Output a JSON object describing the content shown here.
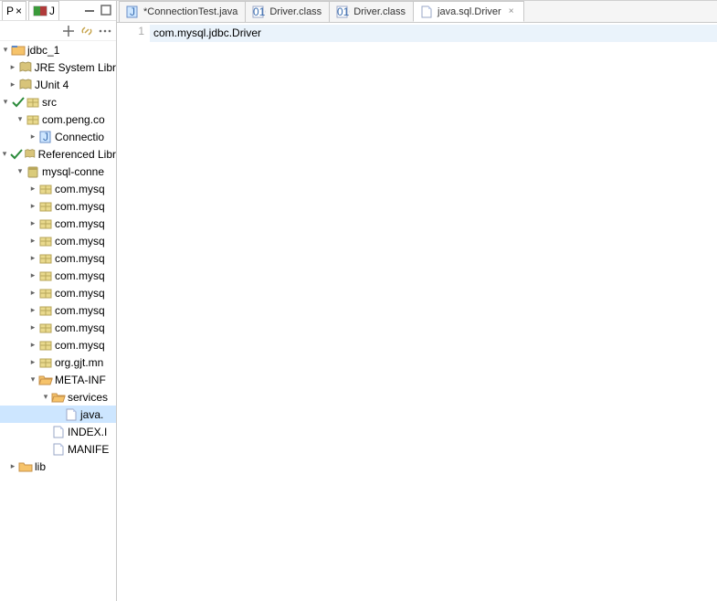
{
  "sidebar": {
    "view_tab_left": "P",
    "view_tab_j": "J",
    "project": "jdbc_1",
    "jre": "JRE System Libr",
    "junit": "JUnit 4",
    "src": "src",
    "pkg_peng": "com.peng.co",
    "connectio": "Connectio",
    "reflib": "Referenced Libr",
    "mysql_conn": "mysql-conne",
    "pkg_mysq": "com.mysq",
    "org_gjt": "org.gjt.mn",
    "meta_inf": "META-INF",
    "services": "services",
    "java_file": "java.",
    "index": "INDEX.I",
    "manifest": "MANIFE",
    "lib": "lib"
  },
  "tabs": [
    {
      "label": "*ConnectionTest.java",
      "icon": "java",
      "active": false
    },
    {
      "label": "Driver.class",
      "icon": "class",
      "active": false
    },
    {
      "label": "Driver.class",
      "icon": "class",
      "active": false
    },
    {
      "label": "java.sql.Driver",
      "icon": "file",
      "active": true
    }
  ],
  "editor": {
    "line_number": "1",
    "content": "com.mysql.jdbc.Driver"
  }
}
